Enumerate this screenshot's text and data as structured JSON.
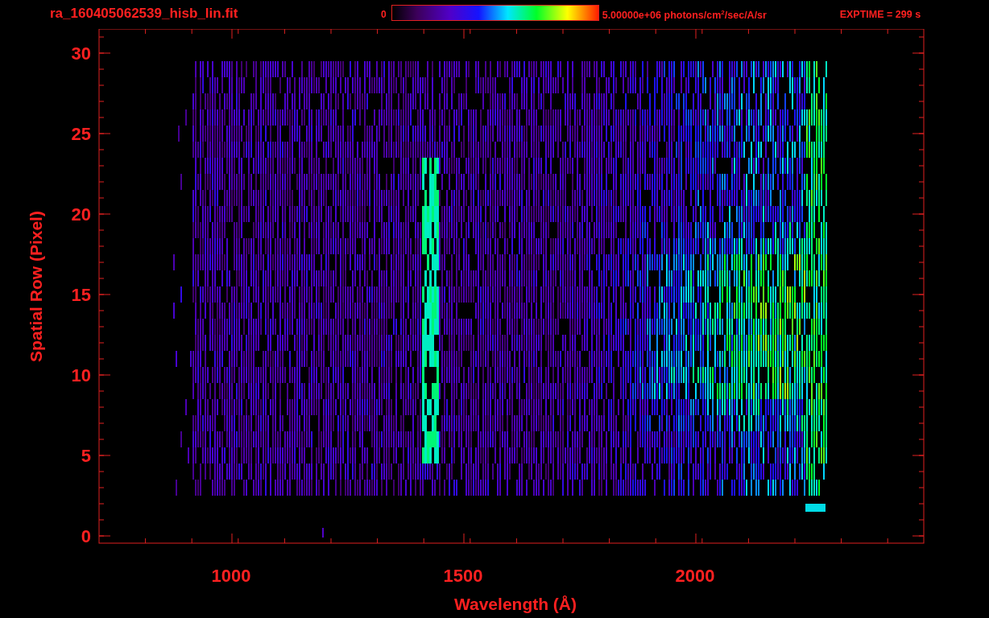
{
  "title": "ra_160405062539_hisb_lin.fit",
  "colorbar": {
    "min_label": "0",
    "max_label": "5.00000e+06 photons/cm$^{2}$/sec/A/sr"
  },
  "exposure": "EXPTIME = 299 s",
  "x_axis": {
    "label": "Wavelength (Å)",
    "ticks": [
      "1000",
      "1500",
      "2000"
    ]
  },
  "y_axis": {
    "label": "Spatial Row (Pixel)",
    "ticks": [
      "30",
      "25",
      "20",
      "15",
      "10",
      "5",
      "0"
    ]
  }
}
